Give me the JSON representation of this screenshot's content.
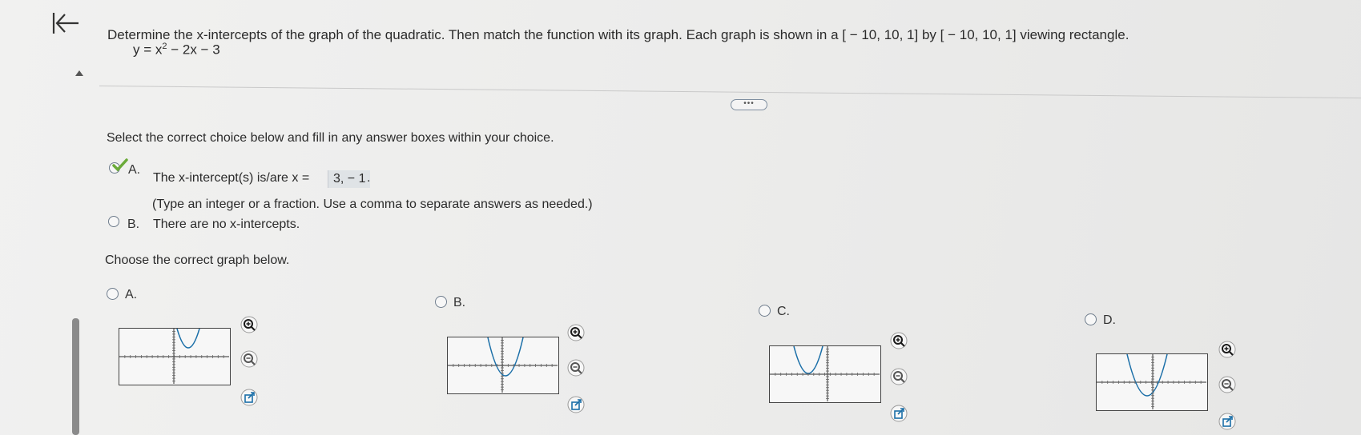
{
  "question": {
    "text": "Determine the x-intercepts of the graph of the quadratic. Then match the function with its graph. Each graph is shown in a [ − 10, 10, 1] by [ − 10, 10, 1] viewing rectangle.",
    "equation_prefix": "y = x",
    "equation_exponent": "2",
    "equation_suffix": " − 2x − 3"
  },
  "more_label": "•••",
  "part1": {
    "instruction": "Select the correct choice below and fill in any answer boxes within your choice.",
    "choice_a": {
      "letter": "A.",
      "text": "The x-intercept(s) is/are x =",
      "answer": "3, − 1",
      "after": ".",
      "hint": "(Type an integer or a fraction. Use a comma to separate answers as needed.)",
      "selected": true
    },
    "choice_b": {
      "letter": "B.",
      "text": "There are no x-intercepts."
    }
  },
  "part2": {
    "instruction": "Choose the correct graph below.",
    "options": [
      {
        "letter": "A."
      },
      {
        "letter": "B."
      },
      {
        "letter": "C."
      },
      {
        "letter": "D."
      }
    ]
  },
  "icons": {
    "back": "first-page-arrow-icon",
    "zoom_in": "zoom-in-icon",
    "zoom_out": "zoom-out-icon",
    "open_external": "open-in-new-window-icon"
  },
  "colors": {
    "accent": "#1b6fa8",
    "check": "#6bab3a",
    "answer_box": "#dfe3e6"
  }
}
